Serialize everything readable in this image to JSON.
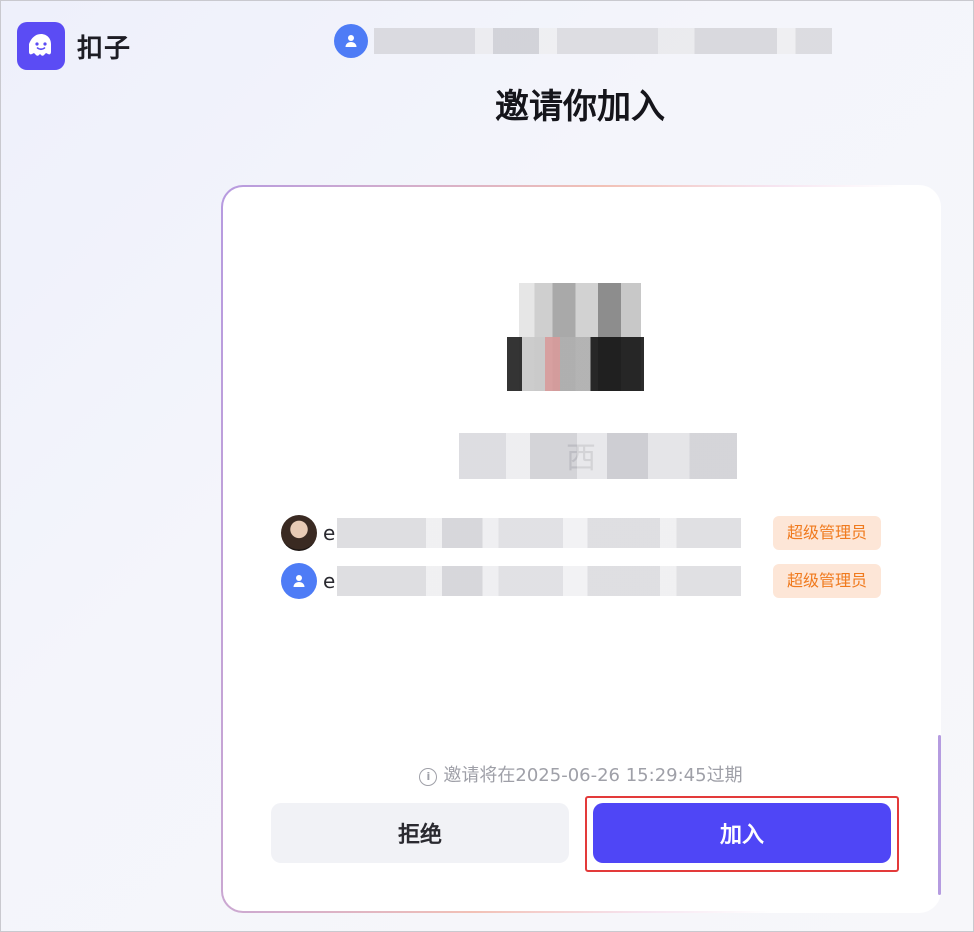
{
  "header": {
    "brand_name": "扣子",
    "logo_icon": "ghost-icon",
    "user_icon": "user-icon",
    "page_title": "邀请你加入"
  },
  "team": {
    "name_initial": "西"
  },
  "members": [
    {
      "initial": "e",
      "avatar": "photo",
      "role": "超级管理员"
    },
    {
      "initial": "e",
      "avatar": "user-icon",
      "role": "超级管理员"
    }
  ],
  "expire_text": "邀请将在2025-06-26 15:29:45过期",
  "actions": {
    "decline_label": "拒绝",
    "join_label": "加入"
  },
  "colors": {
    "brand": "#5b4cf4",
    "primary_button": "#4f46f6",
    "badge_text": "#f07a1e",
    "badge_bg": "#fde6d7",
    "highlight": "#e33a3a"
  }
}
